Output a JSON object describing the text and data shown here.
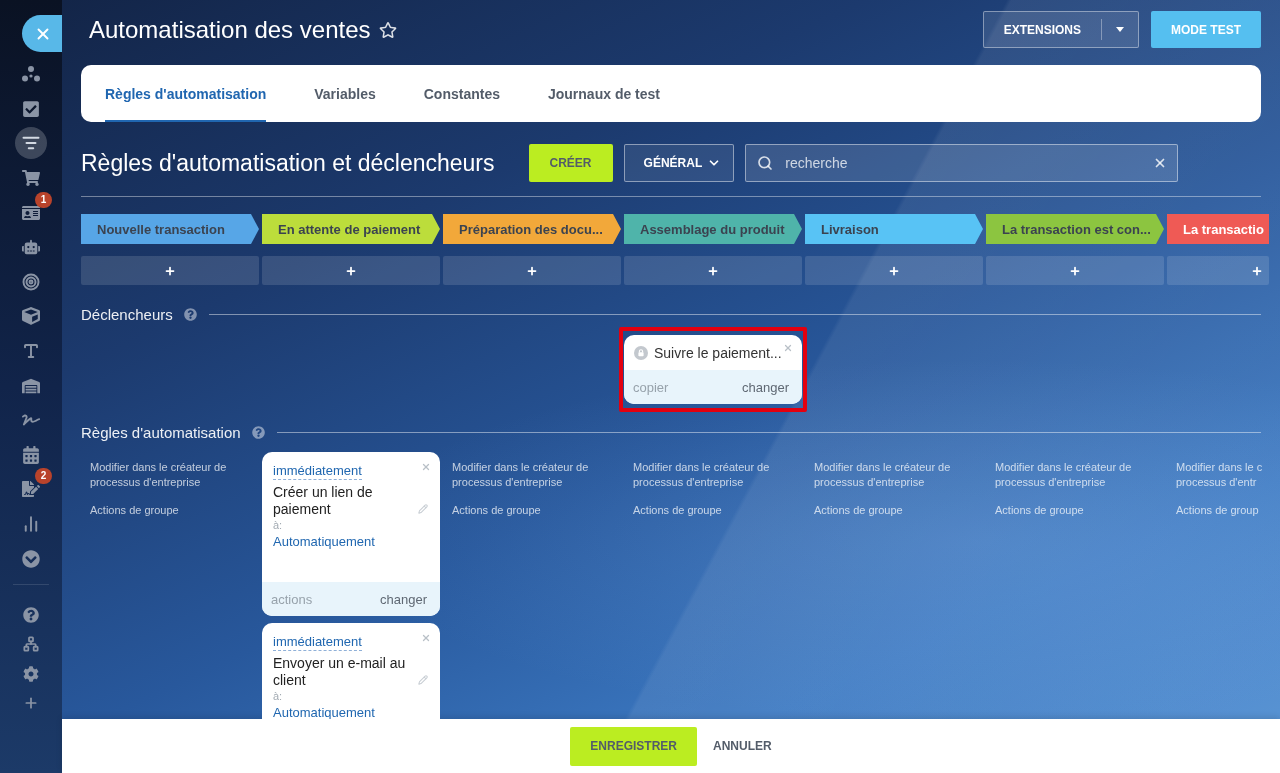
{
  "sidebar": {
    "items": [
      {
        "selected": false
      },
      {
        "selected": false
      },
      {
        "selected": true
      },
      {
        "selected": false
      },
      {
        "selected": false,
        "badge": "1"
      },
      {
        "selected": false
      },
      {
        "selected": false
      },
      {
        "selected": false
      },
      {
        "selected": false
      },
      {
        "selected": false
      },
      {
        "selected": false
      },
      {
        "selected": false
      },
      {
        "selected": false,
        "badge": "2"
      },
      {
        "selected": false
      },
      {
        "selected": false
      }
    ],
    "utility_items": [
      {
        "selected": false
      },
      {
        "selected": false
      },
      {
        "selected": false
      },
      {
        "selected": false
      }
    ]
  },
  "header": {
    "title": "Automatisation des ventes",
    "starred": false,
    "buttons": [
      {
        "label": "EXTENSIONS",
        "kind": "split"
      },
      {
        "label": "MODE TEST",
        "kind": "primary"
      }
    ]
  },
  "tabs": [
    {
      "label": "Règles d'automatisation",
      "selected": true
    },
    {
      "label": "Variables",
      "selected": false
    },
    {
      "label": "Constantes",
      "selected": false
    },
    {
      "label": "Journaux de test",
      "selected": false
    }
  ],
  "toolbar": {
    "title": "Règles d'automatisation et déclencheurs",
    "create_button": "CRÉER",
    "filter_button": "GÉNÉRAL",
    "search": {
      "placeholder": "recherche"
    }
  },
  "sections": {
    "triggers_title": "Déclencheurs",
    "rules_title": "Règles d'automatisation"
  },
  "stages": [
    {
      "name": "Nouvelle transaction",
      "color": "#57a6e7",
      "links": [
        "Modifier dans le créateur de processus d'entreprise",
        "Actions de groupe"
      ]
    },
    {
      "name": "En attente de paiement",
      "color": "#bcdd3b",
      "rules": [
        {
          "delay": "immédiatement",
          "name": "Créer un lien de paiement",
          "recipient_label": "à:",
          "recipient": "Automatiquement",
          "actions": {
            "label": "actions",
            "disabled": true
          },
          "edit": {
            "label": "changer",
            "disabled": false
          }
        },
        {
          "delay": "immédiatement",
          "name": "Envoyer un e-mail au client",
          "recipient_label": "à:",
          "recipient": "Automatiquement"
        }
      ]
    },
    {
      "name": "Préparation des docu...",
      "color": "#f2a83a",
      "links": [
        "Modifier dans le créateur de processus d'entreprise",
        "Actions de groupe"
      ]
    },
    {
      "name": "Assemblage du produit",
      "color": "#4fb4aa",
      "triggers": [
        {
          "name": "Suivre le paiement...",
          "highlighted": true,
          "copy": {
            "label": "copier",
            "disabled": true
          },
          "edit": {
            "label": "changer",
            "disabled": false
          }
        }
      ],
      "links": [
        "Modifier dans le créateur de processus d'entreprise",
        "Actions de groupe"
      ]
    },
    {
      "name": "Livraison",
      "color": "#58c3f5",
      "links": [
        "Modifier dans le créateur de processus d'entreprise",
        "Actions de groupe"
      ]
    },
    {
      "name": "La transaction est con...",
      "color": "#8cc540",
      "links": [
        "Modifier dans le créateur de processus d'entreprise",
        "Actions de groupe"
      ]
    },
    {
      "name": "La transactio",
      "color": "#ef5a55",
      "links": [
        "Modifier dans le c processus d'entr",
        "Actions de group"
      ]
    }
  ],
  "footer": {
    "buttons": [
      {
        "label": "ENREGISTRER",
        "kind": "primary"
      },
      {
        "label": "ANNULER",
        "kind": "link"
      }
    ]
  }
}
